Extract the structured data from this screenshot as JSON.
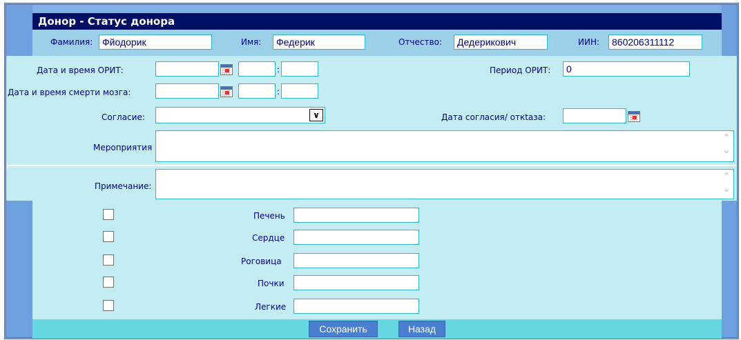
{
  "header": {
    "title": "Донор - Статус донора",
    "surname_label": "Фамилия:",
    "surname_value": "Фйодорик",
    "name_label": "Имя:",
    "name_value": "Федерик",
    "patronymic_label": "Отчество:",
    "patronymic_value": "Дедерикович",
    "iin_label": "ИИН:",
    "iin_value": "860206311112"
  },
  "form": {
    "icu_datetime_label": "Дата и время ОРИТ:",
    "brain_death_label": "Дата и время смерти мозга:",
    "consent_label": "Согласие:",
    "consent_value": "",
    "icu_period_label": "Период ОРИТ:",
    "icu_period_value": "0",
    "consent_date_label": "Дата согласия/ откtаза:",
    "time_separator": ":",
    "activities_label": "Мероприятия",
    "note_label": "Примечание:"
  },
  "organs": [
    {
      "label": "Печень",
      "checked": false,
      "value": ""
    },
    {
      "label": "Сердце",
      "checked": false,
      "value": ""
    },
    {
      "label": "Роговица",
      "checked": false,
      "value": ""
    },
    {
      "label": "Почки",
      "checked": false,
      "value": ""
    },
    {
      "label": "Легкие",
      "checked": false,
      "value": ""
    }
  ],
  "buttons": {
    "save": "Сохранить",
    "back": "Назад"
  },
  "icons": [
    "calendar-icon",
    "chevron-down-icon",
    "scroll-arrows-icon"
  ],
  "colors": {
    "title_bar": "#000e63",
    "form_bg": "#c3ecf3",
    "button": "#4a7fd0",
    "side": "#6fa0e0"
  }
}
